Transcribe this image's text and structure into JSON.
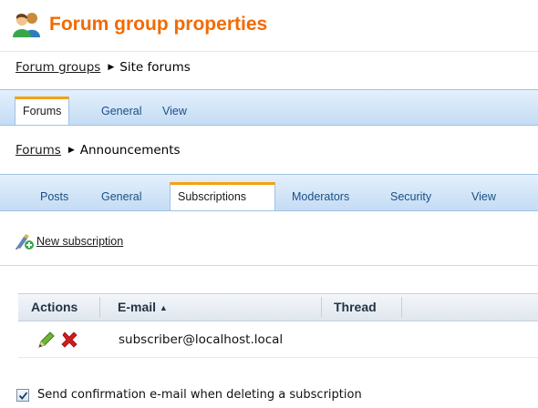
{
  "header": {
    "title": "Forum group properties",
    "icon": "users-group-icon"
  },
  "breadcrumb1": {
    "link": "Forum groups",
    "current": "Site forums"
  },
  "tabs1": [
    {
      "label": "Forums",
      "active": true
    },
    {
      "label": "General",
      "active": false
    },
    {
      "label": "View",
      "active": false
    }
  ],
  "breadcrumb2": {
    "link": "Forums",
    "current": "Announcements"
  },
  "tabs2": [
    {
      "label": "Posts",
      "active": false
    },
    {
      "label": "General",
      "active": false
    },
    {
      "label": "Subscriptions",
      "active": true
    },
    {
      "label": "Moderators",
      "active": false
    },
    {
      "label": "Security",
      "active": false
    },
    {
      "label": "View",
      "active": false
    }
  ],
  "actions": {
    "new_subscription": "New subscription"
  },
  "grid": {
    "columns": [
      "Actions",
      "E-mail",
      "Thread"
    ],
    "sort_indicator": "▲",
    "rows": [
      {
        "email": "subscriber@localhost.local",
        "thread": ""
      }
    ]
  },
  "options": {
    "send_confirmation_label": "Send confirmation e-mail when deleting a subscription",
    "send_confirmation_checked": true
  },
  "colors": {
    "accent": "#f26a00",
    "tab_highlight": "#f5a10d",
    "tabbar": "#c4dcf4"
  }
}
